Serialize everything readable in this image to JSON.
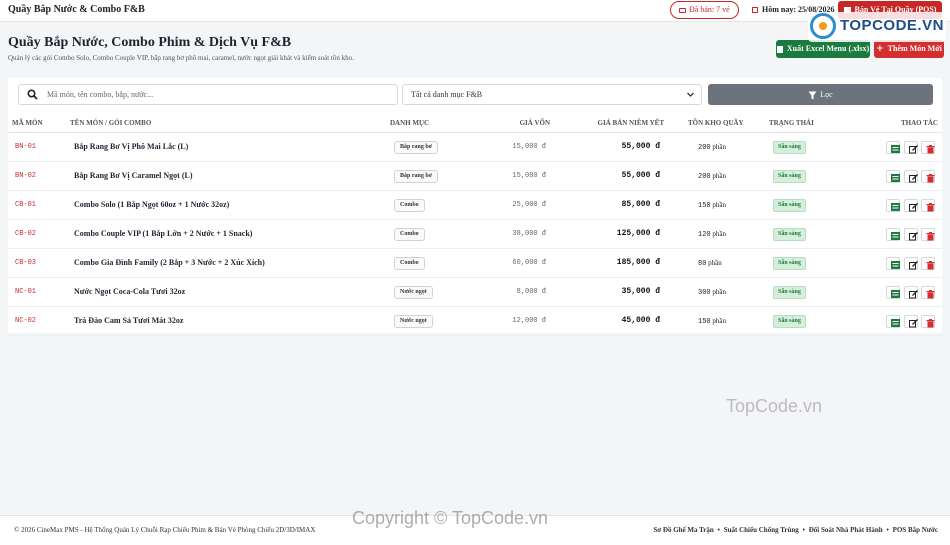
{
  "topbar": {
    "brand": "Quầy Bắp Nước & Combo F&B",
    "sold_badge": "Đã bán: 7 vé",
    "today_label": "Hôm nay:",
    "today_value": "25/08/2026",
    "pos_button": "Bán Vé Tại Quầy (POS)"
  },
  "header": {
    "title": "Quầy Bắp Nước, Combo Phim & Dịch Vụ F&B",
    "subtitle": "Quản lý các gói Combo Solo, Combo Couple VIP, bắp rang bơ phô mai, caramel, nước ngọt giải khát và kiểm soát tồn kho.",
    "export_button": "Xuất Excel Menu (.xlsx)",
    "add_button": "Thêm Món Mới"
  },
  "filter": {
    "search_placeholder": "Mã món, tên combo, bắp, nước...",
    "category_selected": "Tất cả danh mục F&B",
    "filter_button": "Lọc"
  },
  "table": {
    "columns": [
      "MÃ MÓN",
      "TÊN MÓN / GÓI COMBO",
      "DANH MỤC",
      "GIÁ VỐN",
      "GIÁ BÁN NIÊM YẾT",
      "TỒN KHO QUẦY",
      "TRẠNG THÁI",
      "THAO TÁC"
    ],
    "rows": [
      {
        "code": "BN-01",
        "name": "Bắp Rang Bơ Vị Phô Mai Lắc (L)",
        "category": "Bắp rang bơ",
        "cost": "15,000 đ",
        "price": "55,000 đ",
        "stock": "200",
        "unit": "phần",
        "status": "Sẵn sàng"
      },
      {
        "code": "BN-02",
        "name": "Bắp Rang Bơ Vị Caramel Ngọt (L)",
        "category": "Bắp rang bơ",
        "cost": "15,000 đ",
        "price": "55,000 đ",
        "stock": "200",
        "unit": "phần",
        "status": "Sẵn sàng"
      },
      {
        "code": "CB-01",
        "name": "Combo Solo (1 Bắp Ngọt 60oz + 1 Nước 32oz)",
        "category": "Combo",
        "cost": "25,000 đ",
        "price": "85,000 đ",
        "stock": "150",
        "unit": "phần",
        "status": "Sẵn sàng"
      },
      {
        "code": "CB-02",
        "name": "Combo Couple VIP (1 Bắp Lớn + 2 Nước + 1 Snack)",
        "category": "Combo",
        "cost": "38,000 đ",
        "price": "125,000 đ",
        "stock": "120",
        "unit": "phần",
        "status": "Sẵn sàng"
      },
      {
        "code": "CB-03",
        "name": "Combo Gia Đình Family (2 Bắp + 3 Nước + 2 Xúc Xích)",
        "category": "Combo",
        "cost": "60,000 đ",
        "price": "185,000 đ",
        "stock": "80",
        "unit": "phần",
        "status": "Sẵn sàng"
      },
      {
        "code": "NC-01",
        "name": "Nước Ngọt Coca-Cola Tươi 32oz",
        "category": "Nước ngọt",
        "cost": "8,000 đ",
        "price": "35,000 đ",
        "stock": "300",
        "unit": "phần",
        "status": "Sẵn sàng"
      },
      {
        "code": "NC-02",
        "name": "Trà Đào Cam Sả Tươi Mát 32oz",
        "category": "Nước ngọt",
        "cost": "12,000 đ",
        "price": "45,000 đ",
        "stock": "150",
        "unit": "phần",
        "status": "Sẵn sàng"
      }
    ]
  },
  "footer": {
    "copyright": "© 2026 CineMax PMS - Hệ Thống Quản Lý Chuỗi Rạp Chiếu Phim & Bán Vé Phòng Chiếu 2D/3D/IMAX",
    "links": [
      "Sơ Đồ Ghế Ma Trận",
      "Suất Chiếu Chống Trùng",
      "Đối Soát Nhà Phát Hành",
      "POS Bắp Nước"
    ],
    "separator": "•"
  },
  "watermarks": {
    "logo_text": "TOPCODE.VN",
    "middle": "TopCode.vn",
    "bottom": "Copyright © TopCode.vn"
  },
  "icons": {
    "sold": "ticket-icon",
    "today": "calendar-icon",
    "pos": "cash-register-icon",
    "export": "file-excel-icon",
    "add": "plus-icon",
    "search": "search-icon",
    "dropdown": "chevron-down-icon",
    "filter": "filter-icon",
    "row_actions": [
      "excel-icon",
      "edit-icon",
      "trash-icon"
    ]
  },
  "colors": {
    "accent_red": "#c62828",
    "excel_green": "#1b7a3e",
    "filter_gray": "#6c737d",
    "status_bg": "#d6efdd"
  }
}
